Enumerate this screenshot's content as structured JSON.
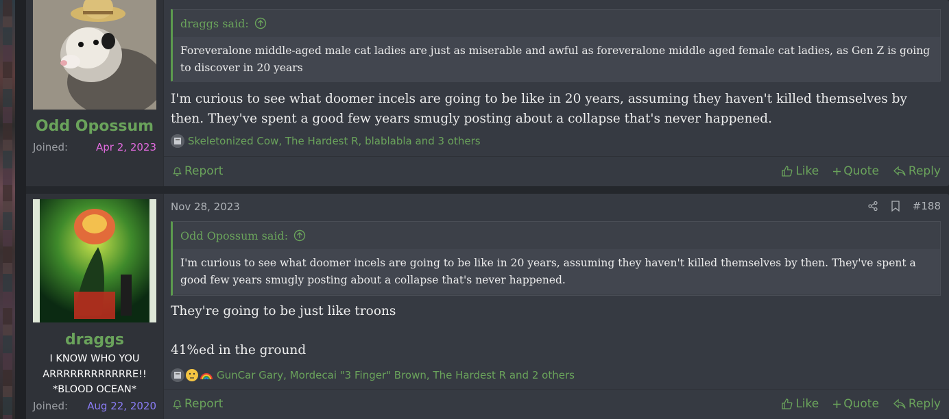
{
  "colors": {
    "accent": "#6aa35b",
    "joined_1": "#e36be0",
    "joined_2": "#8b7df7"
  },
  "posts": [
    {
      "username": "Odd Opossum",
      "joined_label": "Joined:",
      "joined_value": "Apr 2, 2023",
      "quote_author": "draggs said:",
      "quote_text": "Foreveralone middle-aged male cat ladies are just as miserable and awful as foreveralone middle aged female cat ladies, as Gen Z is going to discover in 20 years",
      "message": "I'm curious to see what doomer incels are going to be like in 20 years, assuming they haven't killed themselves by then. They've spent a good few years smugly posting about a collapse that's never happened.",
      "reactions_text": "Skeletonized Cow, The Hardest R, blablabla and 3 others",
      "reaction_icons": [
        "fax-machine-icon"
      ],
      "actions": {
        "report": "Report",
        "like": "Like",
        "quote": "Quote",
        "reply": "Reply"
      }
    },
    {
      "username": "draggs",
      "user_title": "I KNOW WHO YOU ARRRRRRRRRRRRE!! *BLOOD OCEAN*",
      "joined_label": "Joined:",
      "joined_value": "Aug 22, 2020",
      "date": "Nov 28, 2023",
      "post_number": "#188",
      "quote_author": "Odd Opossum said:",
      "quote_text": "I'm curious to see what doomer incels are going to be like in 20 years, assuming they haven't killed themselves by then. They've spent a good few years smugly posting about a collapse that's never happened.",
      "message_line_1": "They're going to be just like troons",
      "message_line_2": "41%ed in the ground",
      "reactions_text": "GunCar Gary, Mordecai \"3 Finger\" Brown, The Hardest R and 2 others",
      "reaction_icons": [
        "fax-machine-icon",
        "thinking-icon",
        "rainbow-icon"
      ],
      "actions": {
        "report": "Report",
        "like": "Like",
        "quote": "Quote",
        "reply": "Reply"
      }
    }
  ]
}
